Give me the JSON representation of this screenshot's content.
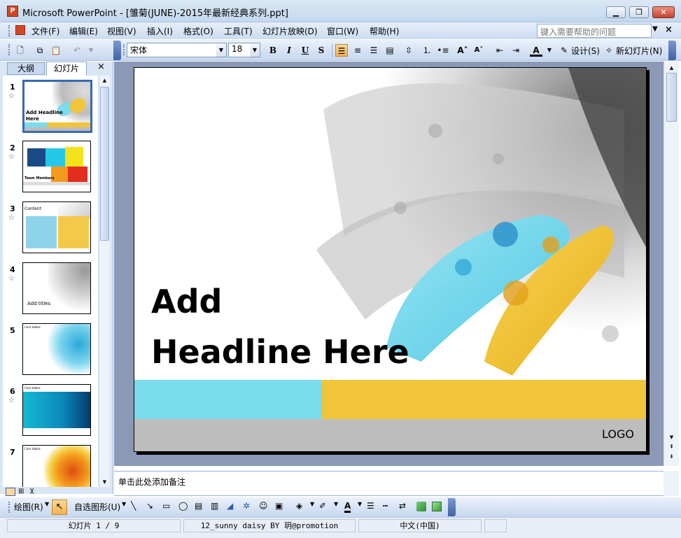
{
  "window": {
    "icon": "P",
    "title": "Microsoft PowerPoint - [雏菊(JUNE)-2015年最新经典系列.ppt]",
    "minimize": "▁",
    "maximize": "❐",
    "close": "✕"
  },
  "menu": {
    "items": [
      "文件(F)",
      "编辑(E)",
      "视图(V)",
      "插入(I)",
      "格式(O)",
      "工具(T)",
      "幻灯片放映(D)",
      "窗口(W)",
      "帮助(H)"
    ],
    "help_placeholder": "键入需要帮助的问题",
    "doc_close": "×"
  },
  "toolbar": {
    "font": "宋体",
    "size": "18",
    "bold": "B",
    "italic": "I",
    "underline": "U",
    "shadow": "S",
    "design": "设计(S)",
    "new_slide": "新幻灯片(N)"
  },
  "panel": {
    "tab_outline": "大纲",
    "tab_slides": "幻灯片",
    "close": "×",
    "slides": [
      {
        "num": "1",
        "text": "Add Headline Here"
      },
      {
        "num": "2",
        "text": "Team Members"
      },
      {
        "num": "3",
        "text": "Content"
      },
      {
        "num": "4",
        "text": "Add titles"
      },
      {
        "num": "5",
        "text": "Core tables"
      },
      {
        "num": "6",
        "text": "Core tables"
      },
      {
        "num": "7",
        "text": "Core tables"
      }
    ]
  },
  "slide": {
    "headline_line1": "Add",
    "headline_line2": "Headline Here",
    "logo": "LOGO",
    "colors": {
      "cyan": "#7adcec",
      "yellow": "#f0c53a",
      "gray": "#bdbdbd"
    }
  },
  "notes": {
    "placeholder": "单击此处添加备注"
  },
  "drawbar": {
    "draw": "绘图(R)",
    "autoshapes": "自选图形(U)"
  },
  "status": {
    "slide_pos": "幻灯片 1 / 9",
    "design": "12_sunny daisy BY 玥@promotion",
    "language": "中文(中国)"
  }
}
